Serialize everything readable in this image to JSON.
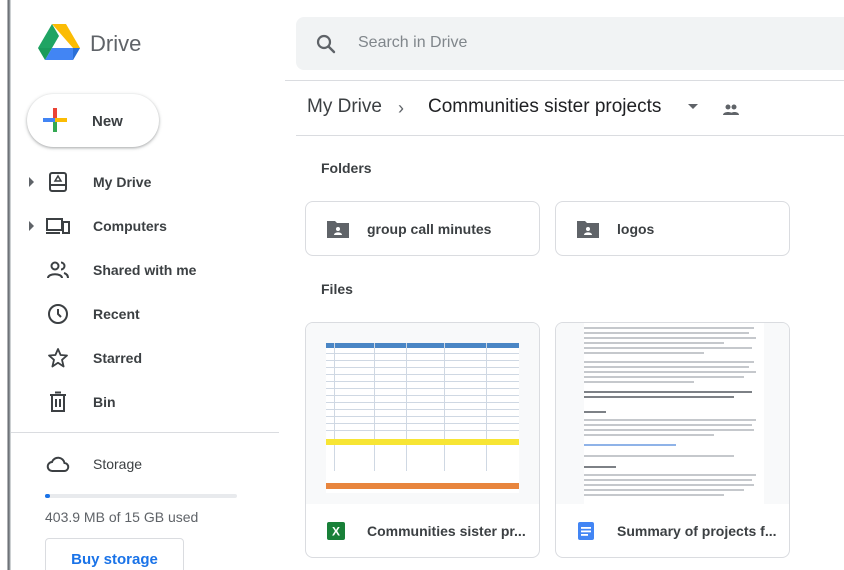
{
  "app": {
    "name": "Drive",
    "logo_icon": "google-drive-logo-icon"
  },
  "search": {
    "placeholder": "Search in Drive",
    "icon": "search-icon"
  },
  "sidebar": {
    "new_label": "New",
    "items": [
      {
        "label": "My Drive",
        "icon": "my-drive-icon",
        "expandable": true
      },
      {
        "label": "Computers",
        "icon": "computers-icon",
        "expandable": true
      },
      {
        "label": "Shared with me",
        "icon": "shared-with-me-icon",
        "expandable": false
      },
      {
        "label": "Recent",
        "icon": "clock-icon",
        "expandable": false
      },
      {
        "label": "Starred",
        "icon": "star-icon",
        "expandable": false
      },
      {
        "label": "Bin",
        "icon": "trash-icon",
        "expandable": false
      }
    ],
    "storage": {
      "label": "Storage",
      "icon": "cloud-icon",
      "usage_text": "403.9 MB of 15 GB used",
      "used_fraction": 0.026,
      "buy_label": "Buy storage"
    }
  },
  "breadcrumb": {
    "root": "My Drive",
    "separator": "›",
    "current": "Communities sister projects",
    "shared_icon": "people-icon"
  },
  "sections": {
    "folders_label": "Folders",
    "files_label": "Files"
  },
  "folders": [
    {
      "name": "group call minutes",
      "icon": "shared-folder-icon"
    },
    {
      "name": "logos",
      "icon": "shared-folder-icon"
    }
  ],
  "files": [
    {
      "name": "Communities sister pr...",
      "type": "spreadsheet",
      "icon": "google-sheets-icon",
      "icon_letter": "X"
    },
    {
      "name": "Summary of projects f...",
      "type": "document",
      "icon": "google-docs-icon"
    }
  ],
  "colors": {
    "accent": "#1a73e8",
    "sheets_green": "#188038",
    "docs_blue": "#4285f4"
  }
}
